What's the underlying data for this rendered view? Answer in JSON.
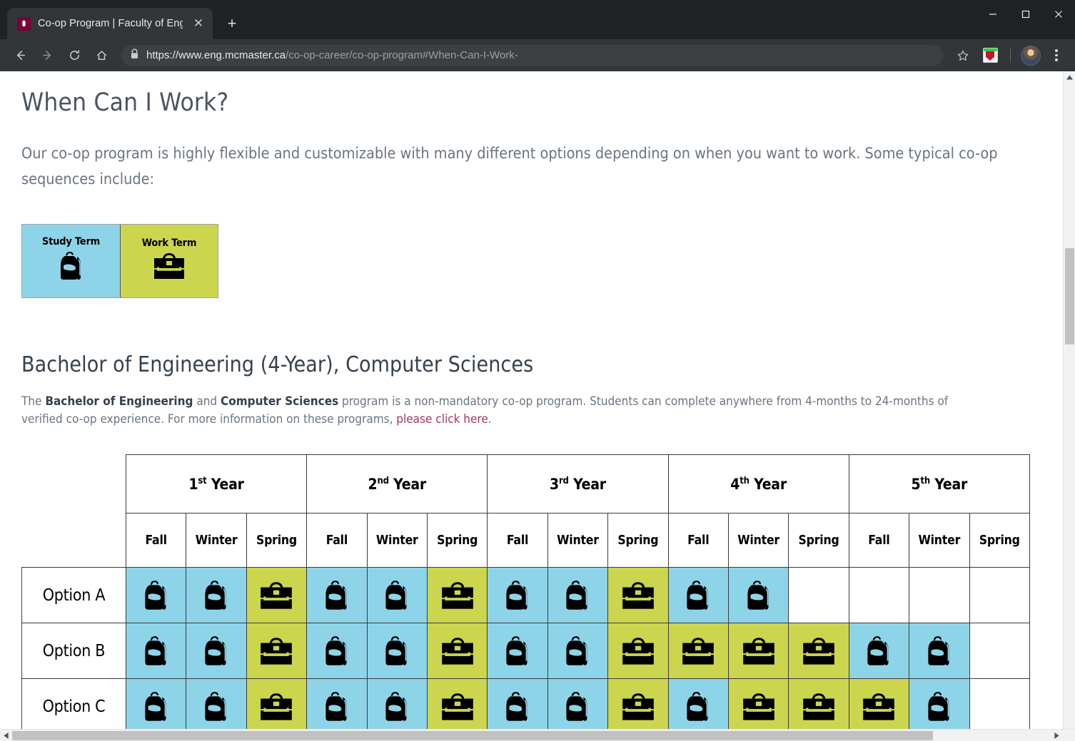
{
  "browser": {
    "tab": {
      "title": "Co-op Program | Faculty of Engin",
      "favicon": "mcmaster-crest-icon",
      "close": "✕"
    },
    "newtab_label": "+",
    "window_controls": {
      "minimize": "—",
      "maximize": "☐",
      "close": "✕"
    },
    "nav": {
      "back": "←",
      "forward": "→",
      "reload": "⟳",
      "home": "⌂"
    },
    "url": {
      "lock": "🔒",
      "domain": "https://www.eng.mcmaster.ca",
      "path": "/co-op-career/co-op-program#When-Can-I-Work-"
    },
    "actions": {
      "bookmark": "☆",
      "extension": "extension-shield-icon",
      "profile": "avatar",
      "menu": "kebab-menu-icon"
    }
  },
  "page": {
    "heading": "When Can I Work?",
    "intro": "Our co-op program is highly flexible and customizable with many different options depending on when you want to work. Some typical co-op sequences include:",
    "legend": [
      {
        "label": "Study Term",
        "icon": "backpack-icon",
        "color": "#8ed4e8"
      },
      {
        "label": "Work Term",
        "icon": "briefcase-icon",
        "color": "#ccd54e"
      }
    ],
    "section_heading": "Bachelor of Engineering (4-Year), Computer Sciences",
    "body_parts": {
      "t1": "The ",
      "b1": "Bachelor of Engineering",
      "t2": " and ",
      "b2": "Computer Sciences",
      "t3": " program is a non-mandatory co-op program. Students can complete anywhere from 4-months to 24-months of verified co-op experience. For more information on these programs, ",
      "link": "please click here",
      "t4": "."
    },
    "link_color": "#a6375a"
  },
  "schedule": {
    "years": [
      {
        "ordinal": "1",
        "suffix": "st",
        "label": "Year"
      },
      {
        "ordinal": "2",
        "suffix": "nd",
        "label": "Year"
      },
      {
        "ordinal": "3",
        "suffix": "rd",
        "label": "Year"
      },
      {
        "ordinal": "4",
        "suffix": "th",
        "label": "Year"
      },
      {
        "ordinal": "5",
        "suffix": "th",
        "label": "Year"
      }
    ],
    "terms": [
      "Fall",
      "Winter",
      "Spring",
      "Fall",
      "Winter",
      "Spring",
      "Fall",
      "Winter",
      "Spring",
      "Fall",
      "Winter",
      "Spring",
      "Fall",
      "Winter",
      "Spring"
    ],
    "rows": [
      {
        "label": "Option A",
        "cells": [
          "study",
          "study",
          "work",
          "study",
          "study",
          "work",
          "study",
          "study",
          "work",
          "study",
          "study",
          "",
          "",
          "",
          ""
        ]
      },
      {
        "label": "Option B",
        "cells": [
          "study",
          "study",
          "work",
          "study",
          "study",
          "work",
          "study",
          "study",
          "work",
          "work",
          "work",
          "work",
          "study",
          "study",
          ""
        ]
      },
      {
        "label": "Option C",
        "cells": [
          "study",
          "study",
          "work",
          "study",
          "study",
          "work",
          "study",
          "study",
          "work",
          "study",
          "work",
          "work",
          "work",
          "study",
          ""
        ]
      }
    ]
  }
}
